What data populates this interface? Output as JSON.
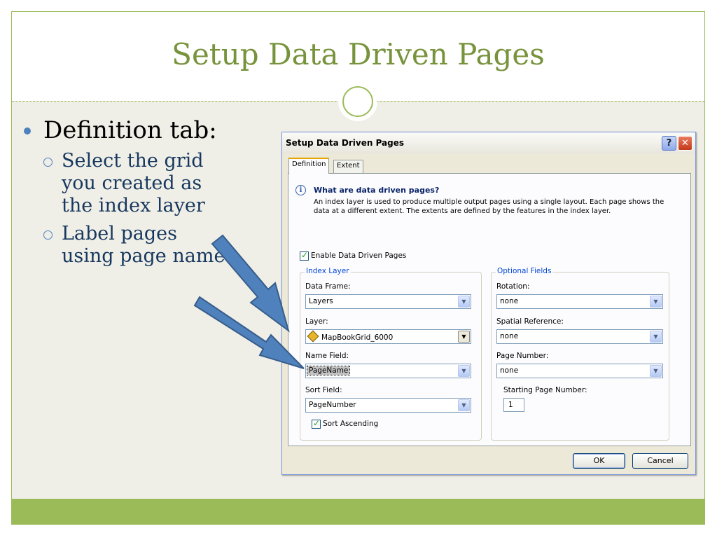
{
  "slide": {
    "title": "Setup Data Driven Pages",
    "bullet": "Definition tab:",
    "subbullets": [
      [
        "Select the grid",
        "you created as",
        "the index layer"
      ],
      [
        "Label pages",
        "using page name"
      ]
    ]
  },
  "dialog": {
    "title": "Setup Data Driven Pages",
    "help_label": "?",
    "close_label": "✕",
    "tabs": [
      "Definition",
      "Extent"
    ],
    "info_head": "What are data driven pages?",
    "info_text": "An index layer is used to produce multiple output pages using a single layout.  Each page shows the data at a different extent.  The extents are defined by the features in the index layer.",
    "enable_label": "Enable Data Driven Pages",
    "index_layer": {
      "title": "Index Layer",
      "data_frame_label": "Data Frame:",
      "data_frame_value": "Layers",
      "layer_label": "Layer:",
      "layer_value": "MapBookGrid_6000",
      "name_field_label": "Name Field:",
      "name_field_value": "PageName",
      "sort_field_label": "Sort Field:",
      "sort_field_value": "PageNumber",
      "sort_ascending_label": "Sort Ascending"
    },
    "optional_fields": {
      "title": "Optional Fields",
      "rotation_label": "Rotation:",
      "rotation_value": "none",
      "spatial_ref_label": "Spatial Reference:",
      "spatial_ref_value": "none",
      "page_number_label": "Page Number:",
      "page_number_value": "none",
      "starting_label": "Starting Page Number:",
      "starting_value": "1"
    },
    "ok_label": "OK",
    "cancel_label": "Cancel"
  },
  "colors": {
    "title_green": "#77933c",
    "accent_green": "#9bbb59",
    "arrow_blue": "#4f81bd",
    "subbullet_text": "#17375e"
  }
}
